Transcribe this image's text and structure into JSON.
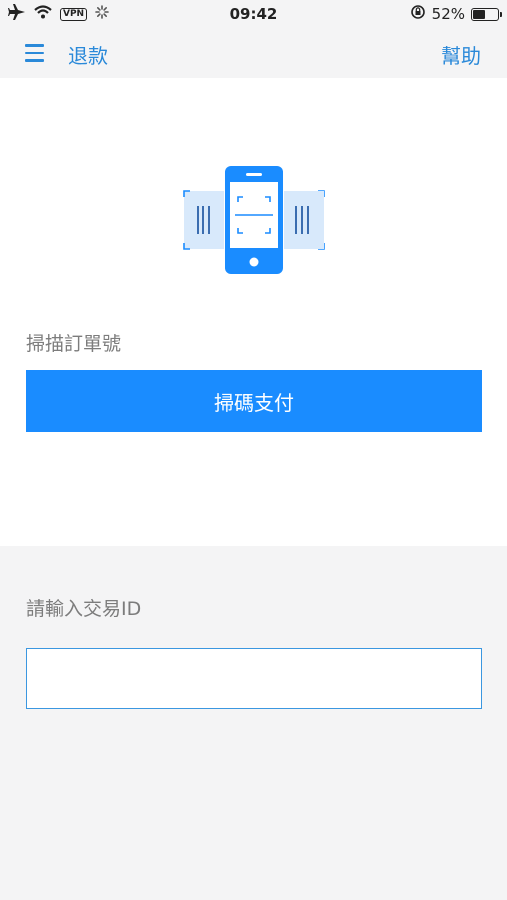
{
  "status_bar": {
    "time": "09:42",
    "vpn": "VPN",
    "battery_percent": "52%",
    "battery_level": 0.52
  },
  "nav": {
    "title": "退款",
    "help_label": "幫助"
  },
  "scan": {
    "label": "掃描訂單號",
    "button_label": "掃碼支付"
  },
  "manual_entry": {
    "label": "請輸入交易ID",
    "value": "",
    "placeholder": ""
  },
  "colors": {
    "accent": "#2a89d9",
    "button": "#1a8cff",
    "background": "#f4f4f5"
  }
}
